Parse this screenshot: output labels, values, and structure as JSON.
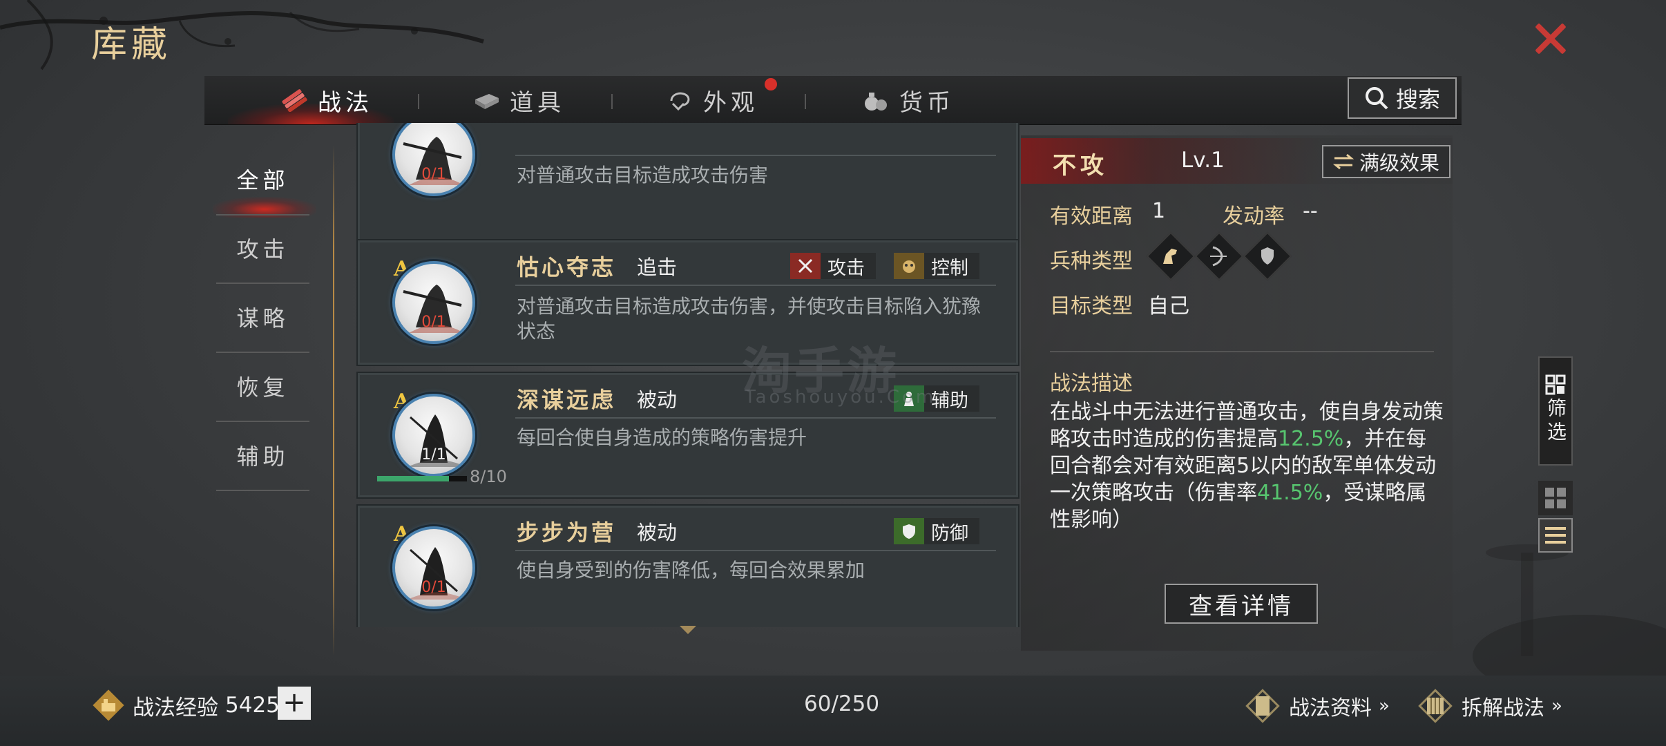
{
  "page": {
    "title": "库藏"
  },
  "tabs": [
    {
      "label": "战法",
      "icon": "scroll-bundle-icon",
      "active": true
    },
    {
      "label": "道具",
      "icon": "item-box-icon",
      "active": false
    },
    {
      "label": "外观",
      "icon": "appearance-swirl-icon",
      "active": false,
      "has_notification": true
    },
    {
      "label": "货币",
      "icon": "money-bag-icon",
      "active": false
    }
  ],
  "search": {
    "label": "搜索",
    "icon": "search-icon"
  },
  "categories": [
    {
      "label": "全部",
      "active": true
    },
    {
      "label": "攻击",
      "active": false
    },
    {
      "label": "谋略",
      "active": false
    },
    {
      "label": "恢复",
      "active": false
    },
    {
      "label": "辅助",
      "active": false
    }
  ],
  "skills": [
    {
      "grade": "A",
      "owned": "0/1",
      "owned_color": "#e34a3a",
      "name": "",
      "kind": "",
      "desc": "对普通攻击目标造成攻击伤害",
      "tags": []
    },
    {
      "grade": "A",
      "owned": "0/1",
      "owned_color": "#e34a3a",
      "name": "怙心夺志",
      "kind": "追击",
      "desc": "对普通攻击目标造成攻击伤害，并使攻击目标陷入犹豫状态",
      "tags": [
        {
          "label": "攻击",
          "icon": "crossed-swords-icon",
          "color": "#8a2a24"
        },
        {
          "label": "控制",
          "icon": "demon-mask-icon",
          "color": "#6b5524"
        }
      ]
    },
    {
      "grade": "A",
      "owned": "1/1",
      "owned_color": "#f0f0f0",
      "name": "深谋远虑",
      "kind": "被动",
      "desc": "每回合使自身造成的策略伤害提升",
      "tags": [
        {
          "label": "辅助",
          "icon": "support-figure-icon",
          "color": "#2e6b3a"
        }
      ],
      "progress_text": "8/10",
      "progress": 0.8
    },
    {
      "grade": "A",
      "owned": "0/1",
      "owned_color": "#e34a3a",
      "name": "步步为营",
      "kind": "被动",
      "desc": "使自身受到的伤害降低，每回合效果累加",
      "tags": [
        {
          "label": "防御",
          "icon": "shield-icon",
          "color": "#3c6b2a"
        }
      ]
    }
  ],
  "detail": {
    "name": "不攻",
    "level": "Lv.1",
    "max_level_button": "满级效果",
    "range_label": "有效距离",
    "range_value": "1",
    "rate_label": "发动率",
    "rate_value": "--",
    "troop_label": "兵种类型",
    "troop_icons": [
      "cavalry-horse-icon",
      "archer-bow-icon",
      "infantry-shield-icon"
    ],
    "target_label": "目标类型",
    "target_value": "自己",
    "desc_title": "战法描述",
    "desc_parts": {
      "a": "在战斗中无法进行普通攻击，使自身发动策略攻击时造成的伤害提高",
      "b": "12.5%",
      "c": "，并在每回合都会对有效距离5以内的敌军单体发动一次策略攻击（伤害率",
      "d": "41.5%",
      "e": "，受谋略属性影响）"
    },
    "view_details_button": "查看详情"
  },
  "side_controls": {
    "filter_label": "筛选",
    "grid_view_icon": "grid-view-icon",
    "list_view_icon": "list-view-icon"
  },
  "bottom": {
    "exp_label": "战法经验",
    "exp_value": "5425",
    "add_label": "+",
    "count": "60/250",
    "link1": "战法资料",
    "link2": "拆解战法",
    "chevrons": "»"
  },
  "watermark": {
    "main": "淘手游",
    "sub": "Taoshouyou.Com"
  },
  "colors": {
    "accent_gold": "#e8cf9c",
    "close_red": "#c83a35",
    "highlight_green": "#57c56f",
    "tab_glow_red": "#dc281e"
  }
}
